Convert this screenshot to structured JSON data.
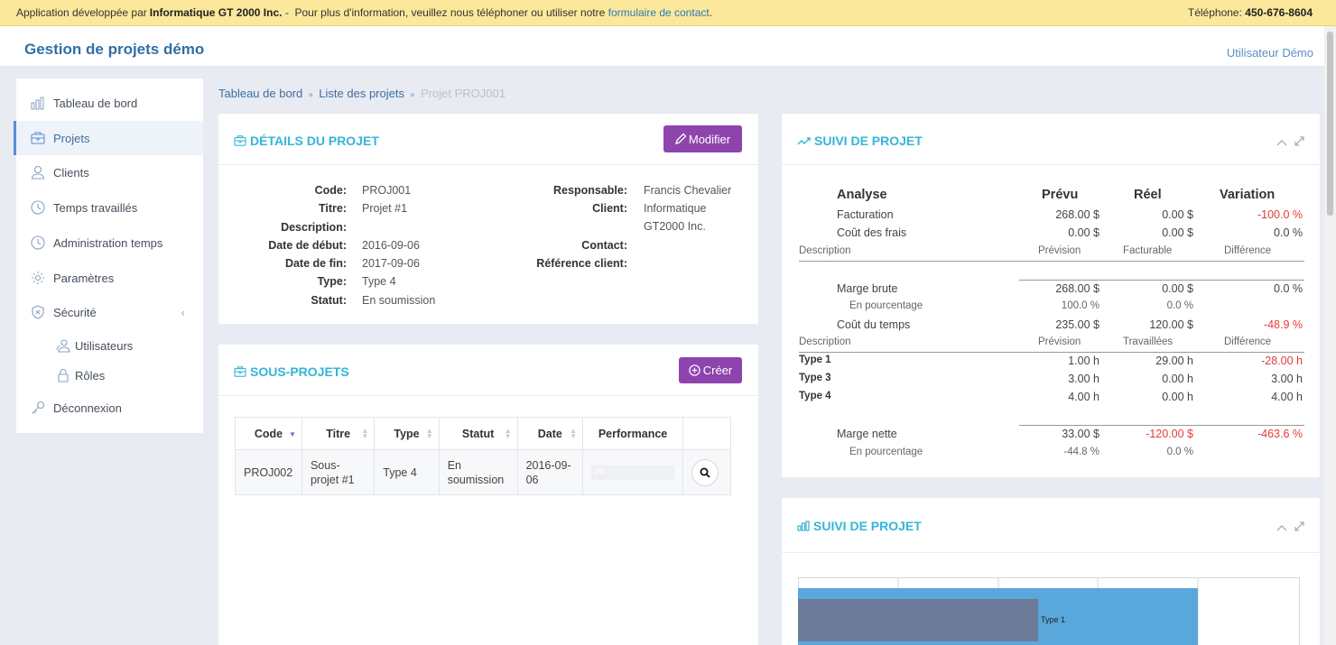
{
  "topbar": {
    "prefix": "Application développée par ",
    "company": "Informatique GT 2000 Inc.",
    "message": " -  Pour plus d'information, veuillez nous téléphoner ou utiliser notre ",
    "link": "formulaire de contact",
    "end": ".",
    "phone_label": "Téléphone: ",
    "phone": "450-676-8604"
  },
  "header": {
    "brand": "Gestion de projets démo",
    "user": "Utilisateur Démo"
  },
  "sidebar": {
    "items": [
      {
        "label": "Tableau de bord",
        "icon": "chart-bar-icon"
      },
      {
        "label": "Projets",
        "icon": "briefcase-icon"
      },
      {
        "label": "Clients",
        "icon": "user-icon"
      },
      {
        "label": "Temps travaillés",
        "icon": "clock-icon"
      },
      {
        "label": "Administration temps",
        "icon": "clock-icon"
      },
      {
        "label": "Paramètres",
        "icon": "gear-icon"
      },
      {
        "label": "Sécurité",
        "icon": "shield-icon"
      }
    ],
    "subitems": [
      {
        "label": "Utilisateurs",
        "icon": "users-icon"
      },
      {
        "label": "Rôles",
        "icon": "lock-icon"
      }
    ],
    "logout": {
      "label": "Déconnexion",
      "icon": "key-icon"
    }
  },
  "breadcrumb": {
    "home": "Tableau de bord",
    "list": "Liste des projets",
    "current": "Projet PROJ001"
  },
  "details": {
    "title": "DÉTAILS DU PROJET",
    "edit_label": "Modifier",
    "left": [
      {
        "k": "Code:",
        "v": "PROJ001"
      },
      {
        "k": "Titre:",
        "v": "Projet #1"
      },
      {
        "k": "Description:",
        "v": ""
      },
      {
        "k": "Date de début:",
        "v": "2016-09-06"
      },
      {
        "k": "Date de fin:",
        "v": "2017-09-06"
      },
      {
        "k": "Type:",
        "v": "Type 4"
      },
      {
        "k": "Statut:",
        "v": "En soumission"
      }
    ],
    "right": {
      "responsable_k": "Responsable:",
      "responsable_v": "Francis Chevalier",
      "client_k": "Client:",
      "client_v1": "Informatique",
      "client_v2": "GT2000 Inc.",
      "contact_k": "Contact:",
      "ref_k": "Référence client:"
    }
  },
  "subprojects": {
    "title": "SOUS-PROJETS",
    "create_label": "Créer",
    "columns": [
      "Code",
      "Titre",
      "Type",
      "Statut",
      "Date",
      "Performance"
    ],
    "rows": [
      {
        "code": "PROJ002",
        "titre1": "Sous-",
        "titre2": "projet #1",
        "type": "Type 4",
        "statut1": "En",
        "statut2": "soumission",
        "date1": "2016-09-",
        "date2": "06",
        "perf": "0%"
      }
    ]
  },
  "suivi": {
    "title": "SUIVI DE PROJET",
    "headers": [
      "Analyse",
      "Prévu",
      "Réel",
      "Variation"
    ],
    "facturation": [
      "Facturation",
      "268.00 $",
      "0.00 $",
      "-100.0 %"
    ],
    "frais": [
      "Coût des frais",
      "0.00 $",
      "0.00 $",
      "0.0 %"
    ],
    "desc1": [
      "Description",
      "Prévision",
      "Facturable",
      "Différence"
    ],
    "marge_brute": [
      "Marge brute",
      "268.00 $",
      "0.00 $",
      "0.0 %"
    ],
    "mb_pct": [
      "En pourcentage",
      "100.0 %",
      "0.0 %"
    ],
    "cout_temps": [
      "Coût du temps",
      "235.00 $",
      "120.00 $",
      "-48.9 %"
    ],
    "desc2": [
      "Description",
      "Prévision",
      "Travaillées",
      "Différence"
    ],
    "types": [
      [
        "Type 1",
        "1.00 h",
        "29.00 h",
        "-28.00 h"
      ],
      [
        "Type 3",
        "3.00 h",
        "0.00 h",
        "3.00 h"
      ],
      [
        "Type 4",
        "4.00 h",
        "0.00 h",
        "4.00 h"
      ]
    ],
    "marge_nette": [
      "Marge nette",
      "33.00 $",
      "-120.00 $",
      "-463.6 %"
    ],
    "mn_pct": [
      "En pourcentage",
      "-44.8 %",
      "0.0 %"
    ]
  },
  "chart_panel": {
    "title": "SUIVI DE PROJET"
  },
  "chart_data": {
    "type": "bar",
    "orientation": "horizontal",
    "categories": [
      "Type 1"
    ],
    "series": [
      {
        "color": "#5aa7dc"
      },
      {
        "color": "#6b7b99"
      }
    ],
    "bar_label": "Type 1"
  }
}
